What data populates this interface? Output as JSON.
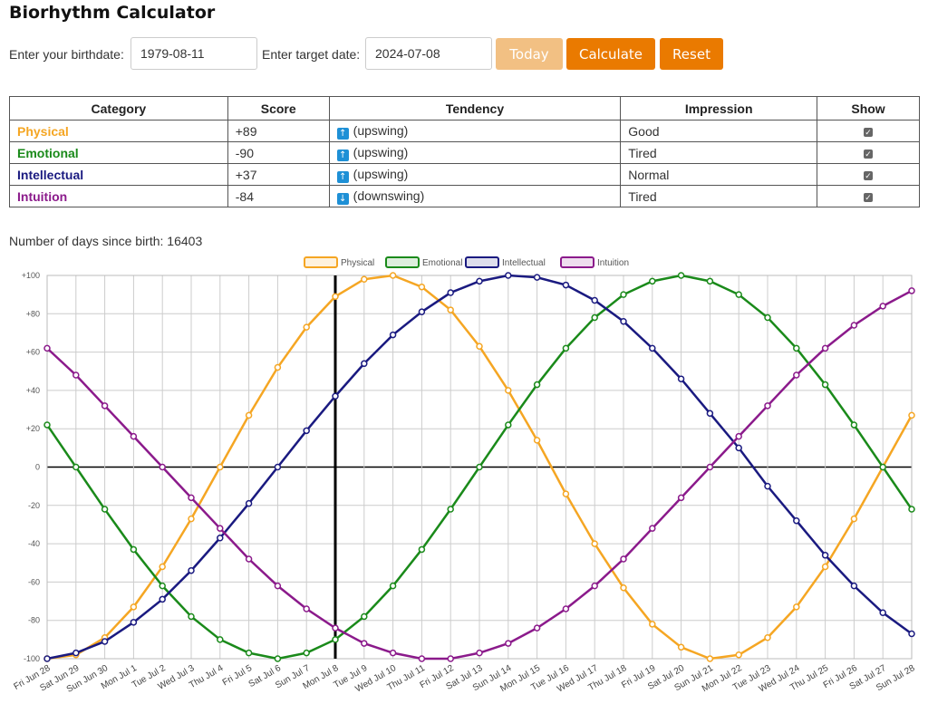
{
  "title": "Biorhythm Calculator",
  "form": {
    "birthdate_label": "Enter your birthdate:",
    "birthdate_value": "1979-08-11",
    "target_label": "Enter target date:",
    "target_value": "2024-07-08",
    "today_label": "Today",
    "calculate_label": "Calculate",
    "reset_label": "Reset"
  },
  "table": {
    "headers": [
      "Category",
      "Score",
      "Tendency",
      "Impression",
      "Show"
    ],
    "rows": [
      {
        "category": "Physical",
        "score": "+89",
        "tendency": "(upswing)",
        "direction": "up",
        "impression": "Good",
        "color": "#f5a623"
      },
      {
        "category": "Emotional",
        "score": "-90",
        "tendency": "(upswing)",
        "direction": "up",
        "impression": "Tired",
        "color": "#1a8a1a"
      },
      {
        "category": "Intellectual",
        "score": "+37",
        "tendency": "(upswing)",
        "direction": "up",
        "impression": "Normal",
        "color": "#1a1a80"
      },
      {
        "category": "Intuition",
        "score": "-84",
        "tendency": "(downswing)",
        "direction": "down",
        "impression": "Tired",
        "color": "#8b1a8b"
      }
    ]
  },
  "days": {
    "label": "Number of days since birth:",
    "value": "16403"
  },
  "chart_data": {
    "type": "line",
    "x": [
      "Fri Jun 28",
      "Sat Jun 29",
      "Sun Jun 30",
      "Mon Jul 1",
      "Tue Jul 2",
      "Wed Jul 3",
      "Thu Jul 4",
      "Fri Jul 5",
      "Sat Jul 6",
      "Sun Jul 7",
      "Mon Jul 8",
      "Tue Jul 9",
      "Wed Jul 10",
      "Thu Jul 11",
      "Fri Jul 12",
      "Sat Jul 13",
      "Sun Jul 14",
      "Mon Jul 15",
      "Tue Jul 16",
      "Wed Jul 17",
      "Thu Jul 18",
      "Fri Jul 19",
      "Sat Jul 20",
      "Sun Jul 21",
      "Mon Jul 22",
      "Tue Jul 23",
      "Wed Jul 24",
      "Thu Jul 25",
      "Fri Jul 26",
      "Sat Jul 27",
      "Sun Jul 28"
    ],
    "ylim": [
      -100,
      100
    ],
    "yticks": [
      100,
      80,
      60,
      40,
      20,
      0,
      -20,
      -40,
      -60,
      -80,
      -100
    ],
    "ytick_labels": [
      "+100",
      "+80",
      "+60",
      "+40",
      "+20",
      "0",
      "-20",
      "-40",
      "-60",
      "-80",
      "-100"
    ],
    "grid": true,
    "legend_position": "top",
    "marker_index": 10,
    "series": [
      {
        "name": "Physical",
        "color": "#f5a623",
        "values": [
          -100,
          -98,
          -89,
          -73,
          -52,
          -27,
          0,
          27,
          52,
          73,
          89,
          98,
          100,
          94,
          82,
          63,
          40,
          14,
          -14,
          -40,
          -63,
          -82,
          -94,
          -100,
          -98,
          -89,
          -73,
          -52,
          -27,
          0,
          27
        ]
      },
      {
        "name": "Emotional",
        "color": "#1a8a1a",
        "values": [
          22,
          0,
          -22,
          -43,
          -62,
          -78,
          -90,
          -97,
          -100,
          -97,
          -90,
          -78,
          -62,
          -43,
          -22,
          0,
          22,
          43,
          62,
          78,
          90,
          97,
          100,
          97,
          90,
          78,
          62,
          43,
          22,
          0,
          -22
        ]
      },
      {
        "name": "Intellectual",
        "color": "#1a1a80",
        "values": [
          -100,
          -97,
          -91,
          -81,
          -69,
          -54,
          -37,
          -19,
          0,
          19,
          37,
          54,
          69,
          81,
          91,
          97,
          100,
          99,
          95,
          87,
          76,
          62,
          46,
          28,
          10,
          -10,
          -28,
          -46,
          -62,
          -76,
          -87
        ]
      },
      {
        "name": "Intuition",
        "color": "#8b1a8b",
        "values": [
          62,
          48,
          32,
          16,
          0,
          -16,
          -32,
          -48,
          -62,
          -74,
          -84,
          -92,
          -97,
          -100,
          -100,
          -97,
          -92,
          -84,
          -74,
          -62,
          -48,
          -32,
          -16,
          0,
          16,
          32,
          48,
          62,
          74,
          84,
          92
        ]
      }
    ]
  }
}
